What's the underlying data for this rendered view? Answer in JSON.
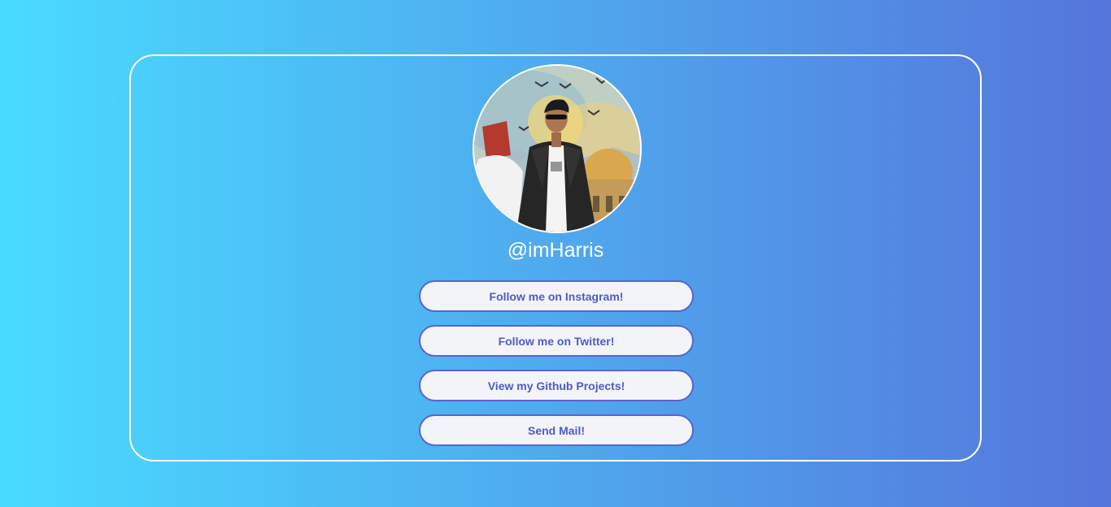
{
  "profile": {
    "handle": "@imHarris",
    "avatar_alt": "profile photo"
  },
  "links": [
    {
      "label": "Follow me on Instagram!"
    },
    {
      "label": "Follow me on Twitter!"
    },
    {
      "label": "View my Github Projects!"
    },
    {
      "label": "Send Mail!"
    }
  ],
  "colors": {
    "gradient_start": "#49dbff",
    "gradient_end": "#5575db",
    "card_border": "#ffffff",
    "button_bg": "#f3f4f7",
    "button_border": "#5a63d1",
    "button_text": "#4d5bc9"
  }
}
